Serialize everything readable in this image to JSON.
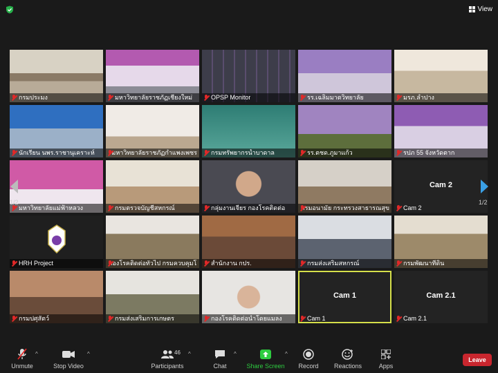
{
  "header": {
    "view_label": "View"
  },
  "tiles": [
    {
      "name": "กรมประมง"
    },
    {
      "name": "มหาวิทยาลัยราชภัฏเชียงใหม่"
    },
    {
      "name": "OPSP Monitor"
    },
    {
      "name": "รร.เฉลิมมาตวิทยาลัย"
    },
    {
      "name": "มรภ.ลำปาง"
    },
    {
      "name": "นักเรียน นพร.ราชานุเคราะห์"
    },
    {
      "name": "มหาวิทยาลัยราชภัฏกำแพงเพชร"
    },
    {
      "name": "กรมทรัพยากรน้ำบาดาล"
    },
    {
      "name": "รร.ตชด.ภูมาแก้ว"
    },
    {
      "name": "รปภ 55 จังหวัดตาก"
    },
    {
      "name": "มหาวิทยาลัยแม่ฟ้าหลวง"
    },
    {
      "name": "กรมตรวจบัญชีสหกรณ์"
    },
    {
      "name": "กลุ่มงานเจียร กองโรคติดต่อ"
    },
    {
      "name": "กรมอนามัย กระทรวงสาธารณสุข"
    },
    {
      "name": "Cam 2",
      "center": "Cam 2"
    },
    {
      "name": "HRH Project"
    },
    {
      "name": "กองโรคติดต่อทั่วไป กรมควบคุมโรค"
    },
    {
      "name": "สำนักงาน กปร."
    },
    {
      "name": "กรมส่งเสริมสหกรณ์"
    },
    {
      "name": "กรมพัฒนาที่ดิน"
    },
    {
      "name": "กรมปศุสัตว์"
    },
    {
      "name": "กรมส่งเสริมการเกษตร"
    },
    {
      "name": "กองโรคติดต่อนำโดยแมลง"
    },
    {
      "name": "Cam 1",
      "center": "Cam 1"
    },
    {
      "name": "Cam 2.1",
      "center": "Cam 2.1"
    }
  ],
  "pagination": {
    "left": "1/2",
    "right": "1/2"
  },
  "toolbar": {
    "unmute": "Unmute",
    "stop_video": "Stop Video",
    "participants": "Participants",
    "participants_count": "46",
    "chat": "Chat",
    "share_screen": "Share Screen",
    "record": "Record",
    "reactions": "Reactions",
    "apps": "Apps",
    "leave": "Leave"
  },
  "colors": {
    "accent_share": "#2ecc40",
    "leave": "#c9262e",
    "active_speaker": "#d6e04a",
    "nav_arrow": "#3aa0e6"
  }
}
